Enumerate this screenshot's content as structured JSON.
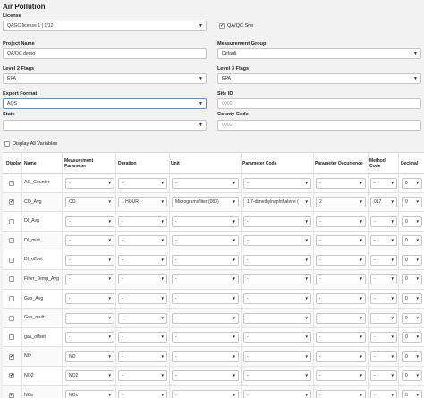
{
  "page": {
    "title": "Air Pollution"
  },
  "form": {
    "license": {
      "label": "License",
      "value": "QAGC license 1 | 1/12"
    },
    "qaqc_site": {
      "label": "QA/QC Site",
      "checked": true
    },
    "project_name": {
      "label": "Project Name",
      "value": "QA/QC demo"
    },
    "measurement_group": {
      "label": "Measurement Group",
      "value": "Default"
    },
    "level2_flags": {
      "label": "Level 2 Flags",
      "value": "EPA"
    },
    "level3_flags": {
      "label": "Level 3 Flags",
      "value": "EPA"
    },
    "export_format": {
      "label": "Export Format",
      "value": "AQS"
    },
    "site_id": {
      "label": "Site ID",
      "placeholder": "0000"
    },
    "state": {
      "label": "State",
      "value": ""
    },
    "county_code": {
      "label": "County Code",
      "placeholder": "0000"
    },
    "display_all": {
      "label": "Display All Variables",
      "checked": false
    }
  },
  "table": {
    "headers": {
      "display": "Display",
      "name": "Name",
      "measurement_parameter": "Measurement Parameter",
      "duration": "Duration",
      "unit": "Unit",
      "parameter_code": "Parameter Code",
      "parameter_occurrence": "Parameter Occurrence",
      "method_code": "Method Code",
      "decimal": "Decimal"
    },
    "rows": [
      {
        "name": "AC_Counter",
        "checked": false,
        "mp": "-",
        "duration": "-",
        "unit": "-",
        "pcode": "-",
        "pocc": "-",
        "method": "-",
        "decimal": "0"
      },
      {
        "name": "CO_Avg",
        "checked": true,
        "mp": "CO",
        "duration": "1 HOUR",
        "unit": "Micrograms/liter (083)",
        "pcode": "1,7-dimethylnaphthalene (",
        "pocc": "2",
        "method": "017",
        "decimal": "0"
      },
      {
        "name": "DI_Avg",
        "checked": false,
        "mp": "-",
        "duration": "-",
        "unit": "-",
        "pcode": "-",
        "pocc": "-",
        "method": "-",
        "decimal": "0"
      },
      {
        "name": "DI_mult",
        "checked": false,
        "mp": "-",
        "duration": "-",
        "unit": "-",
        "pcode": "-",
        "pocc": "-",
        "method": "-",
        "decimal": "0"
      },
      {
        "name": "DI_offset",
        "checked": false,
        "mp": "-",
        "duration": "-",
        "unit": "-",
        "pcode": "-",
        "pocc": "-",
        "method": "-",
        "decimal": "0"
      },
      {
        "name": "Filter_Temp_Avg",
        "checked": false,
        "mp": "-",
        "duration": "-",
        "unit": "-",
        "pcode": "-",
        "pocc": "-",
        "method": "-",
        "decimal": "0"
      },
      {
        "name": "Gas_Avg",
        "checked": false,
        "mp": "-",
        "duration": "-",
        "unit": "-",
        "pcode": "-",
        "pocc": "-",
        "method": "-",
        "decimal": "0"
      },
      {
        "name": "Gas_mult",
        "checked": false,
        "mp": "-",
        "duration": "-",
        "unit": "-",
        "pcode": "-",
        "pocc": "-",
        "method": "-",
        "decimal": "0"
      },
      {
        "name": "gas_offset",
        "checked": false,
        "mp": "-",
        "duration": "-",
        "unit": "-",
        "pcode": "-",
        "pocc": "-",
        "method": "-",
        "decimal": "0"
      },
      {
        "name": "NO",
        "checked": true,
        "mp": "NO",
        "duration": "-",
        "unit": "-",
        "pcode": "-",
        "pocc": "-",
        "method": "-",
        "decimal": "0"
      },
      {
        "name": "NO2",
        "checked": true,
        "mp": "NO2",
        "duration": "-",
        "unit": "-",
        "pcode": "-",
        "pocc": "-",
        "method": "-",
        "decimal": "0"
      },
      {
        "name": "NOx",
        "checked": true,
        "mp": "NOx",
        "duration": "-",
        "unit": "-",
        "pcode": "-",
        "pocc": "-",
        "method": "-",
        "decimal": "0"
      }
    ]
  },
  "icons": {
    "checkmark": "✔",
    "dropdown": "chevron-down-icon"
  }
}
